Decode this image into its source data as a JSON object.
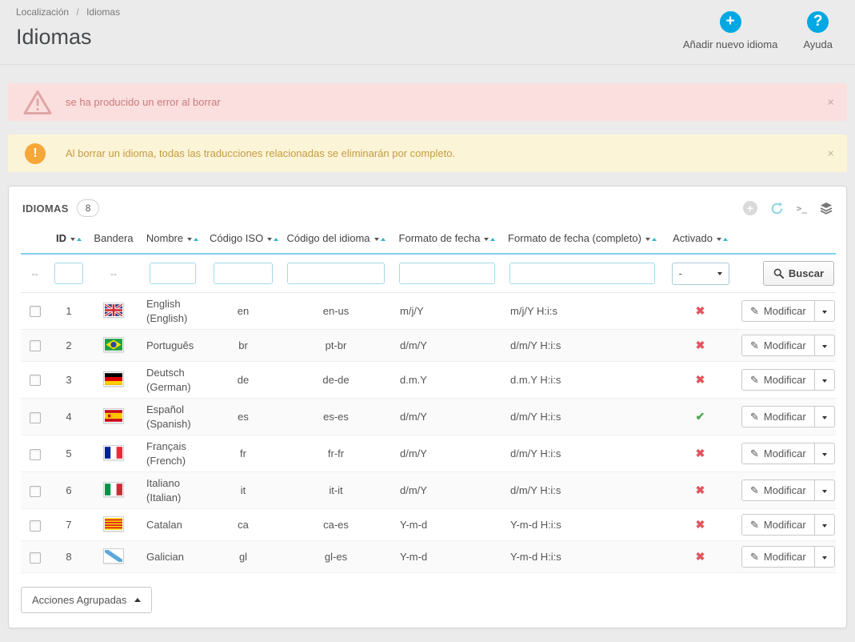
{
  "breadcrumb": {
    "parent": "Localización",
    "separator": "/",
    "current": "Idiomas"
  },
  "page_title": "Idiomas",
  "header_actions": {
    "add_new": {
      "label": "Añadir nuevo idioma",
      "icon_glyph": "+"
    },
    "help": {
      "label": "Ayuda",
      "icon_glyph": "?"
    }
  },
  "alerts": {
    "error": {
      "text": "se ha producido un error al borrar",
      "close_symbol": "×"
    },
    "warning": {
      "text": "Al borrar un idioma, todas las traducciones relacionadas se eliminarán por completo.",
      "close_symbol": "×"
    }
  },
  "panel": {
    "title": "IDIOMAS",
    "count": "8",
    "tools": {
      "add_glyph": "+",
      "terminal_label": ">_"
    }
  },
  "table": {
    "columns": [
      {
        "key": "checkbox",
        "label": "",
        "sortable": false,
        "filter": "dash"
      },
      {
        "key": "id",
        "label": "ID",
        "sortable": true,
        "sorted": true,
        "filter": "input"
      },
      {
        "key": "flag",
        "label": "Bandera",
        "sortable": false,
        "filter": "dash"
      },
      {
        "key": "name",
        "label": "Nombre",
        "sortable": true,
        "filter": "input"
      },
      {
        "key": "iso",
        "label": "Código ISO",
        "sortable": true,
        "filter": "input"
      },
      {
        "key": "lang",
        "label": "Código del idioma",
        "sortable": true,
        "filter": "input"
      },
      {
        "key": "date",
        "label": "Formato de fecha",
        "sortable": true,
        "filter": "input"
      },
      {
        "key": "datefull",
        "label": "Formato de fecha (completo)",
        "sortable": true,
        "filter": "input"
      },
      {
        "key": "active",
        "label": "Activado",
        "sortable": true,
        "filter": "select"
      },
      {
        "key": "actions",
        "label": "",
        "sortable": false,
        "filter": "search"
      }
    ],
    "filter": {
      "dash": "--",
      "select_value": "-",
      "search_button": "Buscar"
    },
    "rows": [
      {
        "id": "1",
        "flag": "gb",
        "name": "English (English)",
        "iso": "en",
        "language_code": "en-us",
        "date_format": "m/j/Y",
        "date_format_full": "m/j/Y H:i:s",
        "active": false
      },
      {
        "id": "2",
        "flag": "br",
        "name": "Português",
        "iso": "br",
        "language_code": "pt-br",
        "date_format": "d/m/Y",
        "date_format_full": "d/m/Y H:i:s",
        "active": false
      },
      {
        "id": "3",
        "flag": "de",
        "name": "Deutsch (German)",
        "iso": "de",
        "language_code": "de-de",
        "date_format": "d.m.Y",
        "date_format_full": "d.m.Y H:i:s",
        "active": false
      },
      {
        "id": "4",
        "flag": "es",
        "name": "Español (Spanish)",
        "iso": "es",
        "language_code": "es-es",
        "date_format": "d/m/Y",
        "date_format_full": "d/m/Y H:i:s",
        "active": true
      },
      {
        "id": "5",
        "flag": "fr",
        "name": "Français (French)",
        "iso": "fr",
        "language_code": "fr-fr",
        "date_format": "d/m/Y",
        "date_format_full": "d/m/Y H:i:s",
        "active": false
      },
      {
        "id": "6",
        "flag": "it",
        "name": "Italiano (Italian)",
        "iso": "it",
        "language_code": "it-it",
        "date_format": "d/m/Y",
        "date_format_full": "d/m/Y H:i:s",
        "active": false
      },
      {
        "id": "7",
        "flag": "ca",
        "name": "Catalan",
        "iso": "ca",
        "language_code": "ca-es",
        "date_format": "Y-m-d",
        "date_format_full": "Y-m-d H:i:s",
        "active": false
      },
      {
        "id": "8",
        "flag": "gl",
        "name": "Galician",
        "iso": "gl",
        "language_code": "gl-es",
        "date_format": "Y-m-d",
        "date_format_full": "Y-m-d H:i:s",
        "active": false
      }
    ],
    "row_action": {
      "modify": "Modificar"
    },
    "status_glyphs": {
      "enabled": "✔",
      "disabled": "✖"
    }
  },
  "bulk_actions": {
    "label": "Acciones Agrupadas"
  },
  "colors": {
    "accent_blue": "#00a8e3",
    "header_rule_blue": "#7fd3ee",
    "enabled_green": "#4daa53",
    "disabled_red": "#e0565f"
  }
}
